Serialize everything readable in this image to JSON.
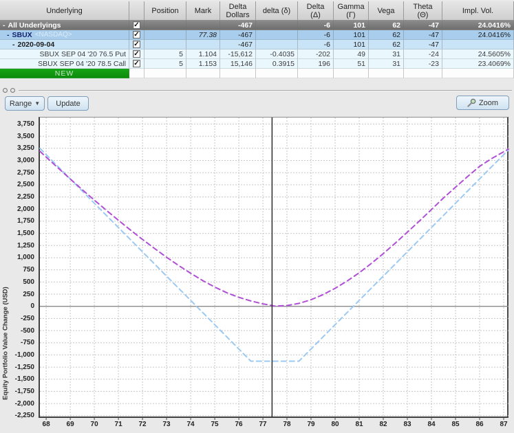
{
  "table": {
    "headers": {
      "underlying": "Underlying",
      "check": "",
      "position": "Position",
      "mark": "Mark",
      "delta_dollars": "Delta\nDollars",
      "delta_small": "delta (δ)",
      "delta_cap": "Delta (Δ)",
      "gamma": "Gamma (Γ)",
      "vega": "Vega",
      "theta": "Theta (Θ)",
      "impl_vol": "Impl. Vol."
    },
    "rows": [
      {
        "collapse": "-",
        "name": "All Underlyings",
        "checked": true,
        "pos": "",
        "mark": "",
        "dd": "-467",
        "ds": "",
        "dc": "-6",
        "gamma": "101",
        "vega": "62",
        "theta": "-47",
        "iv": "24.0416%"
      },
      {
        "collapse": "-",
        "name": "SBUX",
        "suffix": "<NASDAQ>",
        "checked": true,
        "pos": "",
        "mark": "77.38",
        "dd": "-467",
        "ds": "",
        "dc": "-6",
        "gamma": "101",
        "vega": "62",
        "theta": "-47",
        "iv": "24.0416%"
      },
      {
        "collapse": "-",
        "name": "2020-09-04",
        "checked": true,
        "pos": "",
        "mark": "",
        "dd": "-467",
        "ds": "",
        "dc": "-6",
        "gamma": "101",
        "vega": "62",
        "theta": "-47",
        "iv": ""
      },
      {
        "name": "SBUX SEP 04 '20 76.5 Put",
        "checked": true,
        "pos": "5",
        "mark": "1.104",
        "dd": "-15,612",
        "ds": "-0.4035",
        "dc": "-202",
        "gamma": "49",
        "vega": "31",
        "theta": "-24",
        "iv": "24.5605%"
      },
      {
        "name": "SBUX SEP 04 '20 78.5 Call",
        "checked": true,
        "pos": "5",
        "mark": "1.153",
        "dd": "15,146",
        "ds": "0.3915",
        "dc": "196",
        "gamma": "51",
        "vega": "31",
        "theta": "-23",
        "iv": "23.4069%"
      },
      {
        "name": "NEW"
      }
    ],
    "check_glyph": "✓"
  },
  "toolbar": {
    "range_label": "Range",
    "update_label": "Update",
    "zoom_label": "Zoom"
  },
  "chart_data": {
    "type": "line",
    "ylabel": "Equity Portfolio Value Change (USD)",
    "xlabel": "",
    "grid": true,
    "legend": "none",
    "x_range": [
      67.74,
      87.2
    ],
    "y_range": [
      -2281,
      3884
    ],
    "x_ticks": [
      68,
      69,
      70,
      71,
      72,
      73,
      74,
      75,
      76,
      77,
      78,
      79,
      80,
      81,
      82,
      83,
      84,
      85,
      86,
      87
    ],
    "y_ticks": [
      -2250,
      -2000,
      -1750,
      -1500,
      -1250,
      -1000,
      -750,
      -500,
      -250,
      0,
      250,
      500,
      750,
      1000,
      1250,
      1500,
      1750,
      2000,
      2250,
      2500,
      2750,
      3000,
      3250,
      3500,
      3750
    ],
    "price_line_x": 77.38,
    "x": [
      67.74,
      68,
      68.5,
      69,
      69.5,
      70,
      70.5,
      71,
      71.5,
      72,
      72.5,
      73,
      73.5,
      74,
      74.5,
      75,
      75.5,
      76,
      76.5,
      77,
      77.5,
      78,
      78.5,
      79,
      79.5,
      80,
      80.5,
      81,
      81.5,
      82,
      82.5,
      83,
      83.5,
      84,
      84.5,
      85,
      85.5,
      86,
      86.5,
      87,
      87.2
    ],
    "series": [
      {
        "name": "light-blue-dashed-line",
        "color": "#9cc9f2",
        "values": [
          3251,
          3121,
          2871,
          2621,
          2371,
          2121,
          1871,
          1621,
          1371,
          1121,
          871,
          621,
          371,
          121,
          -128,
          -378,
          -628,
          -878,
          -1128,
          -1128,
          -1128,
          -1128,
          -1128,
          -878,
          -628,
          -378,
          -128,
          121,
          371,
          621,
          871,
          1121,
          1371,
          1621,
          1871,
          2121,
          2371,
          2621,
          2871,
          3121,
          3221
        ]
      },
      {
        "name": "purple-dashed-line",
        "color": "#b04fd6",
        "values": [
          3190,
          3070,
          2845,
          2620,
          2400,
          2185,
          1975,
          1770,
          1570,
          1375,
          1190,
          1010,
          840,
          680,
          530,
          395,
          280,
          185,
          110,
          50,
          5,
          15,
          60,
          135,
          240,
          370,
          520,
          690,
          880,
          1085,
          1300,
          1525,
          1755,
          1990,
          2230,
          2450,
          2670,
          2880,
          3040,
          3180,
          3235
        ]
      }
    ]
  }
}
